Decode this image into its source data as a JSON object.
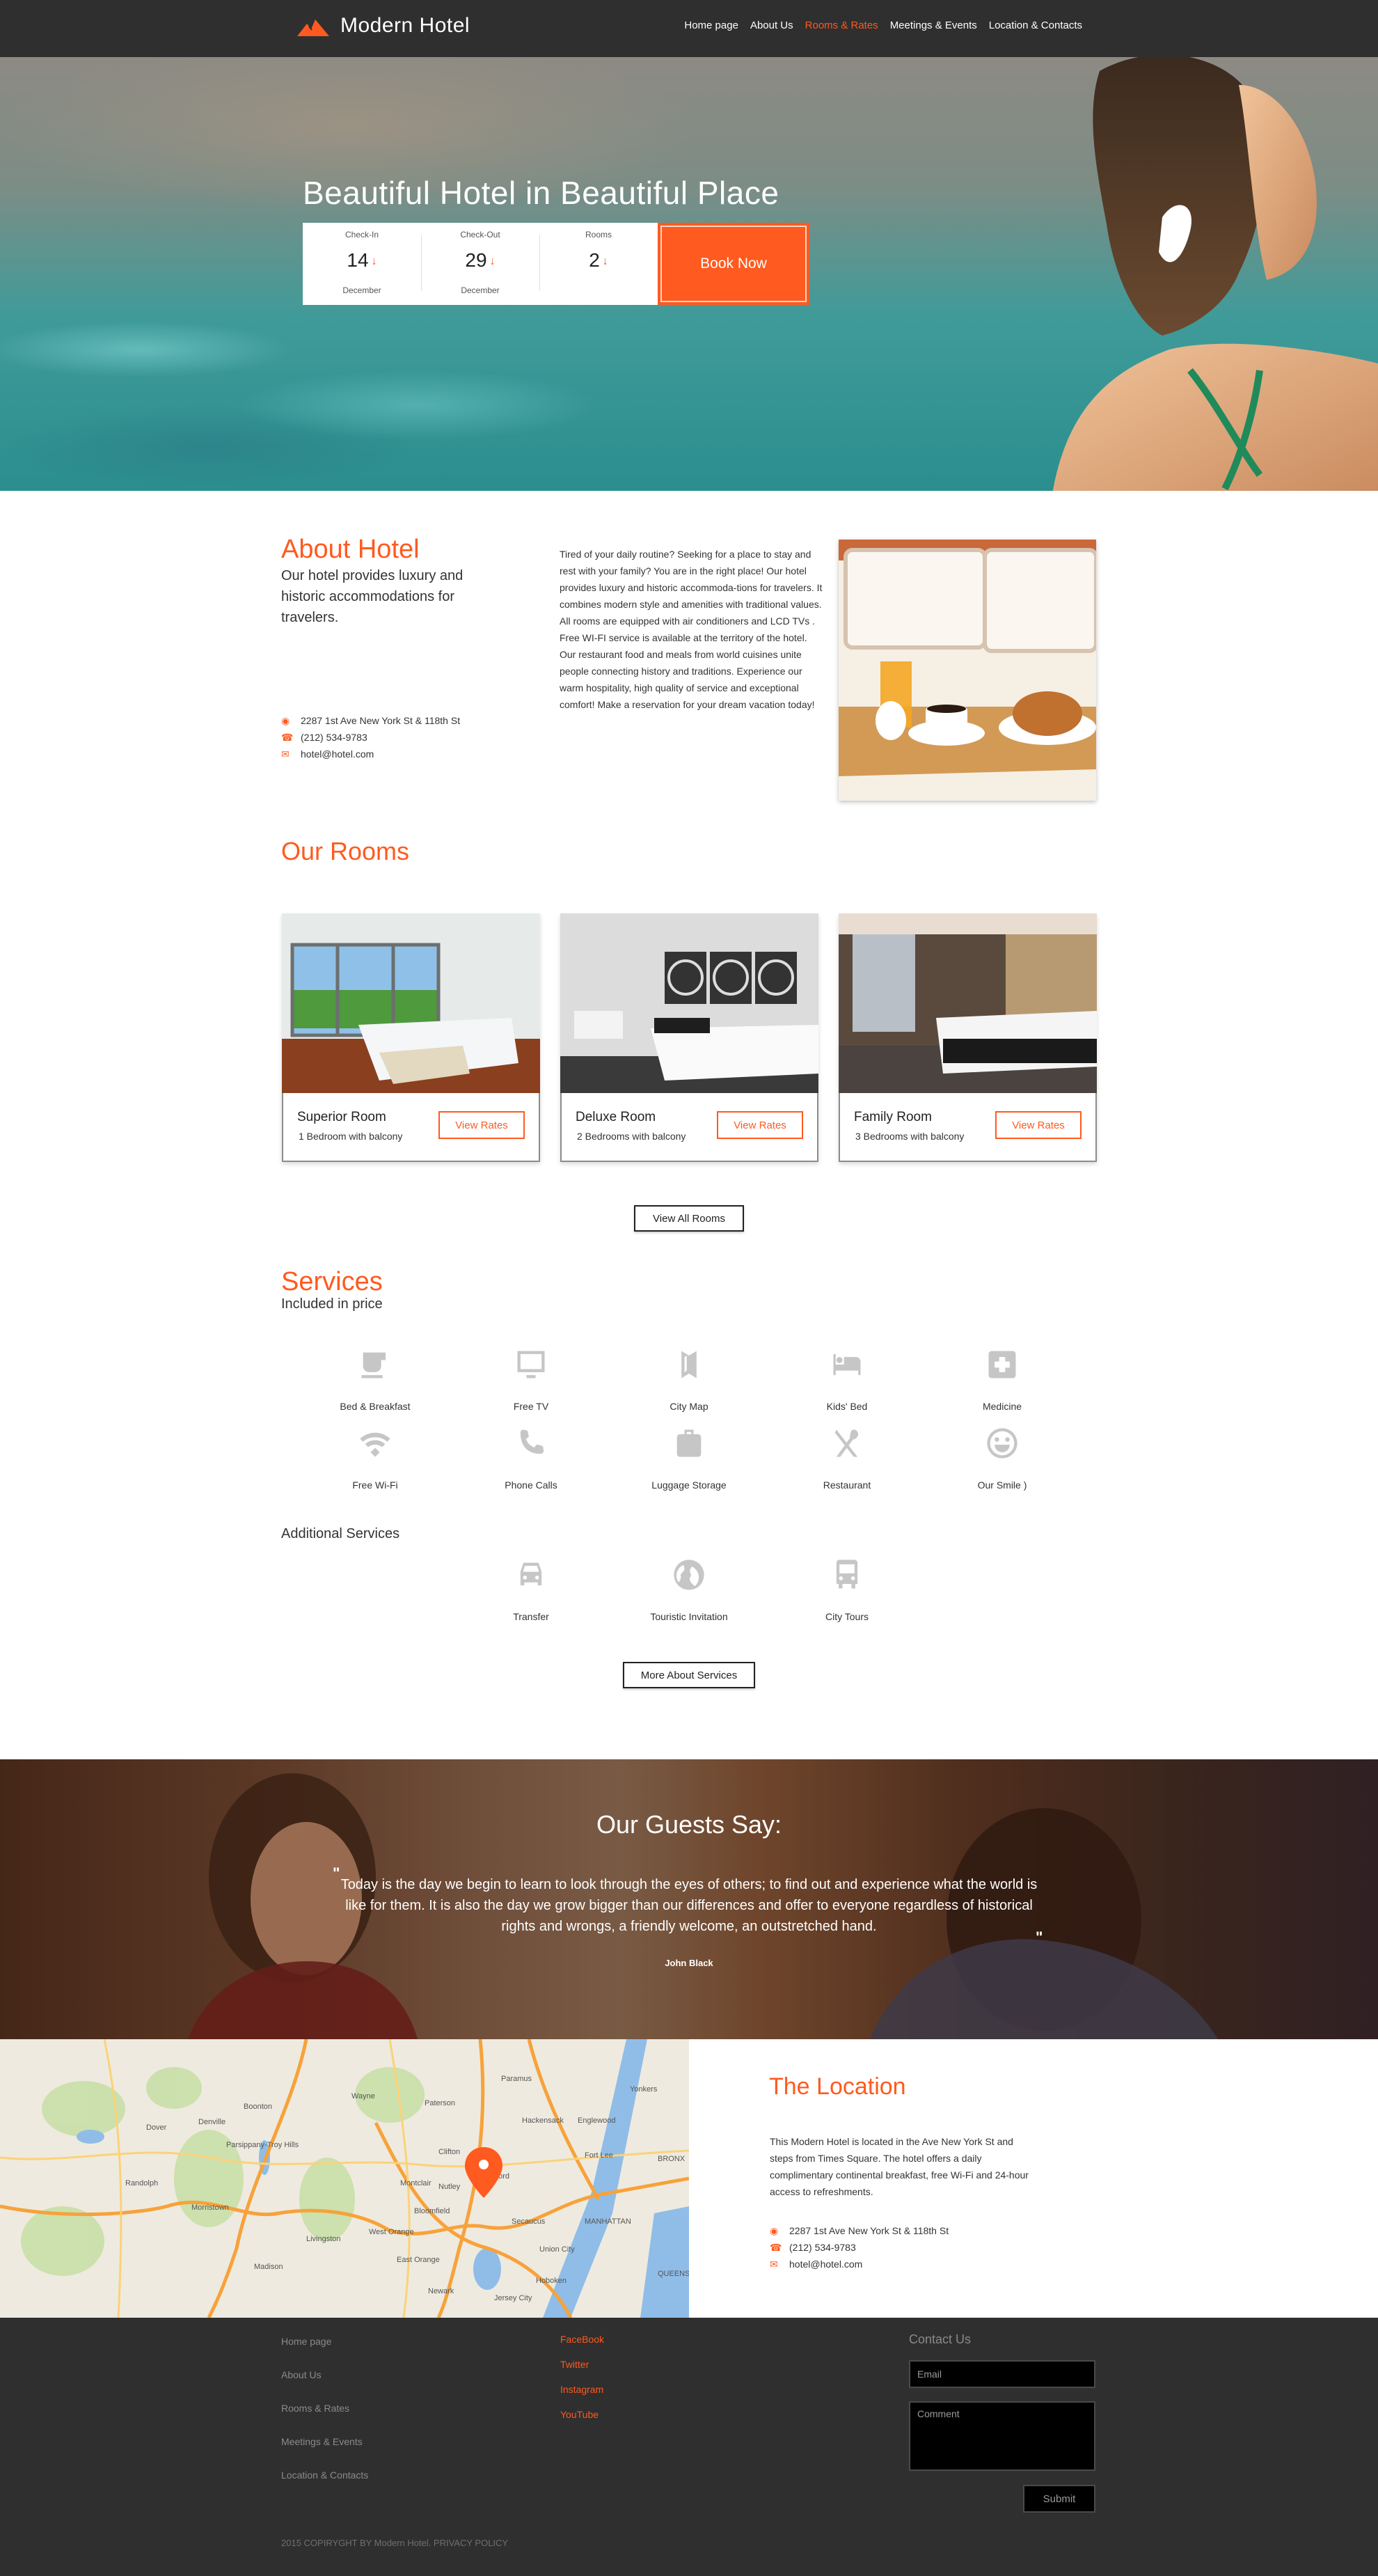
{
  "brand": {
    "name": "Modern Hotel",
    "accent_color": "#ff5a1f",
    "header_bg": "#2f2f2f"
  },
  "nav": {
    "items": [
      {
        "label": "Home page",
        "active": false
      },
      {
        "label": "About Us",
        "active": false
      },
      {
        "label": "Rooms & Rates",
        "active": true
      },
      {
        "label": "Meetings & Events",
        "active": false
      },
      {
        "label": "Location & Contacts",
        "active": false
      }
    ]
  },
  "hero": {
    "title": "Beautiful Hotel in Beautiful Place",
    "booking": {
      "checkin": {
        "label": "Check-In",
        "value": "14",
        "month": "December",
        "icon": "arrow-down-icon"
      },
      "checkout": {
        "label": "Check-Out",
        "value": "29",
        "month": "December",
        "icon": "arrow-down-icon"
      },
      "rooms": {
        "label": "Rooms",
        "value": "2",
        "icon": "arrow-down-icon"
      },
      "book_now_label": "Book Now"
    }
  },
  "about": {
    "title": "About Hotel",
    "lead": "Our hotel provides luxury and historic accommodations for travelers.",
    "body": "Tired of your daily routine? Seeking for a place to stay and rest with your family? You are in the right place! Our hotel provides luxury and historic accommoda-tions for travelers. It combines modern style and amenities with traditional values. All rooms are equipped with air conditioners and LCD TVs . Free WI-FI service is available at the territory of the hotel. Our restaurant food and meals from world cuisines unite people connecting history and traditions. Experience our warm hospitality, high quality of service and exceptional comfort! Make a reservation for your dream vacation today!",
    "contacts": {
      "address": "2287 1st Ave New York St & 118th St",
      "phone": "(212) 534-9783",
      "email": "hotel@hotel.com"
    }
  },
  "rooms": {
    "title": "Our Rooms",
    "items": [
      {
        "name": "Superior Room",
        "desc": "1 Bedroom with balcony",
        "button": "View Rates"
      },
      {
        "name": "Deluxe Room",
        "desc": "2 Bedrooms with balcony",
        "button": "View Rates"
      },
      {
        "name": "Family Room",
        "desc": "3 Bedrooms with balcony",
        "button": "View Rates"
      }
    ],
    "view_all_label": "View All Rooms"
  },
  "services": {
    "title": "Services",
    "subtitle": "Included in price",
    "included": [
      {
        "label": "Bed & Breakfast",
        "icon": "coffee-cup-icon"
      },
      {
        "label": "Free TV",
        "icon": "tv-icon"
      },
      {
        "label": "City Map",
        "icon": "map-icon"
      },
      {
        "label": "Kids' Bed",
        "icon": "bed-icon"
      },
      {
        "label": "Medicine",
        "icon": "medical-cross-icon"
      },
      {
        "label": "Free Wi-Fi",
        "icon": "wifi-icon"
      },
      {
        "label": "Phone Calls",
        "icon": "phone-icon"
      },
      {
        "label": "Luggage Storage",
        "icon": "luggage-icon"
      },
      {
        "label": "Restaurant",
        "icon": "cutlery-icon"
      },
      {
        "label": "Our Smile )",
        "icon": "smile-icon"
      }
    ],
    "additional_title": "Additional Services",
    "additional": [
      {
        "label": "Transfer",
        "icon": "car-icon"
      },
      {
        "label": "Touristic Invitation",
        "icon": "globe-icon"
      },
      {
        "label": "City Tours",
        "icon": "bus-icon"
      }
    ],
    "more_label": "More About Services"
  },
  "testimonial": {
    "title": "Our Guests Say:",
    "quote": "Today is the day we begin to learn to look through the eyes of others; to find out and experience what the world is like for them. It is also the day we grow bigger than our differences and offer to everyone regardless of historical rights and wrongs, a friendly welcome, an outstretched hand.",
    "author": "John Black",
    "open_mark": "\"",
    "close_mark": "\""
  },
  "location": {
    "title": "The Location",
    "body": "This Modern Hotel is located in the Ave New York St and steps from Times Square. The hotel offers a daily complimentary continental breakfast, free Wi-Fi and 24-hour access to refreshments.",
    "contacts": {
      "address": "2287 1st Ave New York St & 118th St",
      "phone": "(212) 534-9783",
      "email": "hotel@hotel.com"
    },
    "map_labels": [
      "Paterson",
      "Wayne",
      "Paramus",
      "Yonkers",
      "Hackensack",
      "Clifton",
      "Montclair",
      "Morristown",
      "Newark",
      "Jersey City",
      "Hoboken",
      "Union City",
      "Englewood",
      "Fort Lee",
      "West Orange",
      "East Orange",
      "Parsippany-Troy Hills",
      "Dover",
      "Randolph",
      "Livingston",
      "MANHATTAN",
      "BRONX",
      "QUEENS",
      "Denville",
      "Boonton",
      "Rutherford",
      "Nutley",
      "Bloomfield",
      "Secaucus",
      "Madison"
    ]
  },
  "footer": {
    "nav": [
      "Home page",
      "About Us",
      "Rooms & Rates",
      "Meetings & Events",
      "Location & Contacts"
    ],
    "social": [
      "FaceBook",
      "Twitter",
      "Instagram",
      "YouTube"
    ],
    "contact_title": "Contact Us",
    "email_placeholder": "Email",
    "comment_placeholder": "Comment",
    "submit_label": "Submit",
    "copyright": "2015 COPIRYGHT BY Modern Hotel. PRIVACY POLICY"
  }
}
